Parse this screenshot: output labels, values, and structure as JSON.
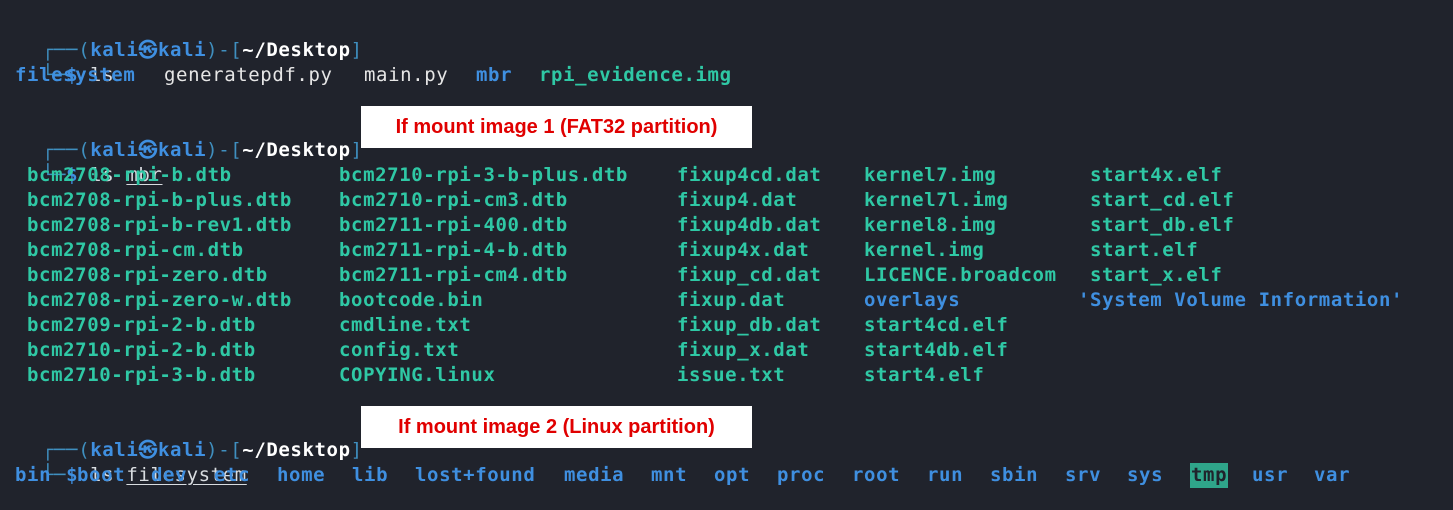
{
  "prompt": {
    "open": "┌──(",
    "user": "kali",
    "at": "㉿",
    "host": "kali",
    "mid": ")-[",
    "path": "~/Desktop",
    "close": "]",
    "corner": "└─",
    "dollar": "$"
  },
  "blocks": [
    {
      "cmd": "ls",
      "arg": "",
      "callout": "",
      "output": [
        {
          "name": "filesystem",
          "kind": "dir"
        },
        {
          "name": "generatepdf.py",
          "kind": "file"
        },
        {
          "name": "main.py",
          "kind": "file"
        },
        {
          "name": "mbr",
          "kind": "dir"
        },
        {
          "name": "rpi_evidence.img",
          "kind": "exec"
        }
      ]
    },
    {
      "cmd": "ls",
      "arg": "mbr",
      "callout": "If mount image 1 (FAT32 partition)",
      "columns": [
        [
          "bcm2708-rpi-b.dtb",
          "bcm2708-rpi-b-plus.dtb",
          "bcm2708-rpi-b-rev1.dtb",
          "bcm2708-rpi-cm.dtb",
          "bcm2708-rpi-zero.dtb",
          "bcm2708-rpi-zero-w.dtb",
          "bcm2709-rpi-2-b.dtb",
          "bcm2710-rpi-2-b.dtb",
          "bcm2710-rpi-3-b.dtb"
        ],
        [
          "bcm2710-rpi-3-b-plus.dtb",
          "bcm2710-rpi-cm3.dtb",
          "bcm2711-rpi-400.dtb",
          "bcm2711-rpi-4-b.dtb",
          "bcm2711-rpi-cm4.dtb",
          "bootcode.bin",
          "cmdline.txt",
          "config.txt",
          "COPYING.linux"
        ],
        [
          "fixup4cd.dat",
          "fixup4.dat",
          "fixup4db.dat",
          "fixup4x.dat",
          "fixup_cd.dat",
          "fixup.dat",
          "fixup_db.dat",
          "fixup_x.dat",
          "issue.txt"
        ],
        [
          "kernel7.img",
          "kernel7l.img",
          "kernel8.img",
          "kernel.img",
          "LICENCE.broadcom",
          "overlays",
          "start4cd.elf",
          "start4db.elf",
          "start4.elf"
        ],
        [
          "start4x.elf",
          "start_cd.elf",
          "start_db.elf",
          "start.elf",
          "start_x.elf",
          "'System Volume Information'"
        ]
      ],
      "dir_entries": [
        "overlays",
        "'System Volume Information'"
      ]
    },
    {
      "cmd": "ls",
      "arg": "filesystem",
      "callout": "If mount image 2 (Linux partition)",
      "output": [
        {
          "name": "bin",
          "kind": "dir"
        },
        {
          "name": "boot",
          "kind": "dir"
        },
        {
          "name": "dev",
          "kind": "dir"
        },
        {
          "name": "etc",
          "kind": "dir"
        },
        {
          "name": "home",
          "kind": "dir"
        },
        {
          "name": "lib",
          "kind": "dir"
        },
        {
          "name": "lost+found",
          "kind": "dir"
        },
        {
          "name": "media",
          "kind": "dir"
        },
        {
          "name": "mnt",
          "kind": "dir"
        },
        {
          "name": "opt",
          "kind": "dir"
        },
        {
          "name": "proc",
          "kind": "dir"
        },
        {
          "name": "root",
          "kind": "dir"
        },
        {
          "name": "run",
          "kind": "dir"
        },
        {
          "name": "sbin",
          "kind": "dir"
        },
        {
          "name": "srv",
          "kind": "dir"
        },
        {
          "name": "sys",
          "kind": "dir"
        },
        {
          "name": "tmp",
          "kind": "sticky"
        },
        {
          "name": "usr",
          "kind": "dir"
        },
        {
          "name": "var",
          "kind": "dir"
        }
      ]
    }
  ]
}
